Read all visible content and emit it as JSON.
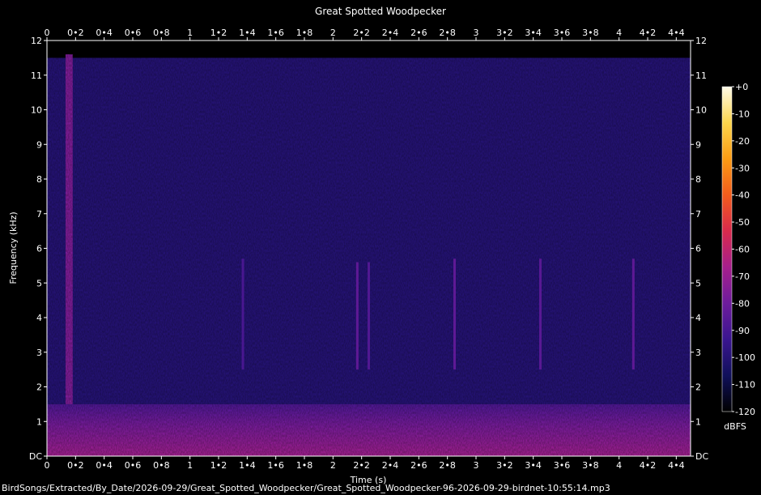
{
  "chart_data": {
    "type": "heatmap",
    "title": "Great Spotted Woodpecker",
    "xlabel": "Time (s)",
    "ylabel": "Frequency (kHz)",
    "footer": "BirdSongs/Extracted/By_Date/2026-09-29/Great_Spotted_Woodpecker/Great_Spotted_Woodpecker-96-2026-09-29-birdnet-10:55:14.mp3",
    "xlim": [
      0,
      4.5
    ],
    "ylim": [
      0,
      12
    ],
    "x_ticks": [
      0,
      0.2,
      0.4,
      0.6,
      0.8,
      1,
      1.2,
      1.4,
      1.6,
      1.8,
      2,
      2.2,
      2.4,
      2.6,
      2.8,
      3,
      3.2,
      3.4,
      3.6,
      3.8,
      4,
      4.2,
      4.4
    ],
    "x_tick_labels": [
      "0",
      "0•2",
      "0•4",
      "0•6",
      "0•8",
      "1",
      "1•2",
      "1•4",
      "1•6",
      "1•8",
      "2",
      "2•2",
      "2•4",
      "2•6",
      "2•8",
      "3",
      "3•2",
      "3•4",
      "3•6",
      "3•8",
      "4",
      "4•2",
      "4•4"
    ],
    "y_ticks": [
      0,
      1,
      2,
      3,
      4,
      5,
      6,
      7,
      8,
      9,
      10,
      11,
      12
    ],
    "y_tick_labels": [
      "DC",
      "1",
      "2",
      "3",
      "4",
      "5",
      "6",
      "7",
      "8",
      "9",
      "10",
      "11",
      "12"
    ],
    "colorbar": {
      "label": "dBFS",
      "range": [
        -120,
        0
      ],
      "ticks": [
        0,
        -10,
        -20,
        -30,
        -40,
        -50,
        -60,
        -70,
        -80,
        -90,
        -100,
        -110,
        -120
      ],
      "tick_labels": [
        "+0",
        "-10",
        "-20",
        "-30",
        "-40",
        "-50",
        "-60",
        "-70",
        "-80",
        "-90",
        "-100",
        "-110",
        "-120"
      ],
      "colors": [
        "#000000",
        "#10105a",
        "#3a1590",
        "#6d1c9c",
        "#a61f8c",
        "#d92a4c",
        "#f25c1c",
        "#fb9b14",
        "#fcd54c",
        "#fffbe8"
      ]
    },
    "regions": [
      {
        "t0": 0,
        "t1": 4.5,
        "f0": 0,
        "f1": 1.5,
        "db": -80
      },
      {
        "t0": 0,
        "t1": 4.5,
        "f0": 1.5,
        "f1": 11.5,
        "db": -100
      },
      {
        "t0": 0.13,
        "t1": 0.18,
        "f0": 0.5,
        "f1": 11.6,
        "db": -76
      }
    ],
    "events": [
      {
        "t": 1.37,
        "f0": 2.5,
        "f1": 5.7,
        "db": -88
      },
      {
        "t": 2.17,
        "f0": 2.5,
        "f1": 5.6,
        "db": -82
      },
      {
        "t": 2.25,
        "f0": 2.5,
        "f1": 5.6,
        "db": -86
      },
      {
        "t": 2.85,
        "f0": 2.5,
        "f1": 5.7,
        "db": -82
      },
      {
        "t": 3.45,
        "f0": 2.5,
        "f1": 5.7,
        "db": -84
      },
      {
        "t": 4.1,
        "f0": 2.5,
        "f1": 5.7,
        "db": -82
      }
    ]
  }
}
